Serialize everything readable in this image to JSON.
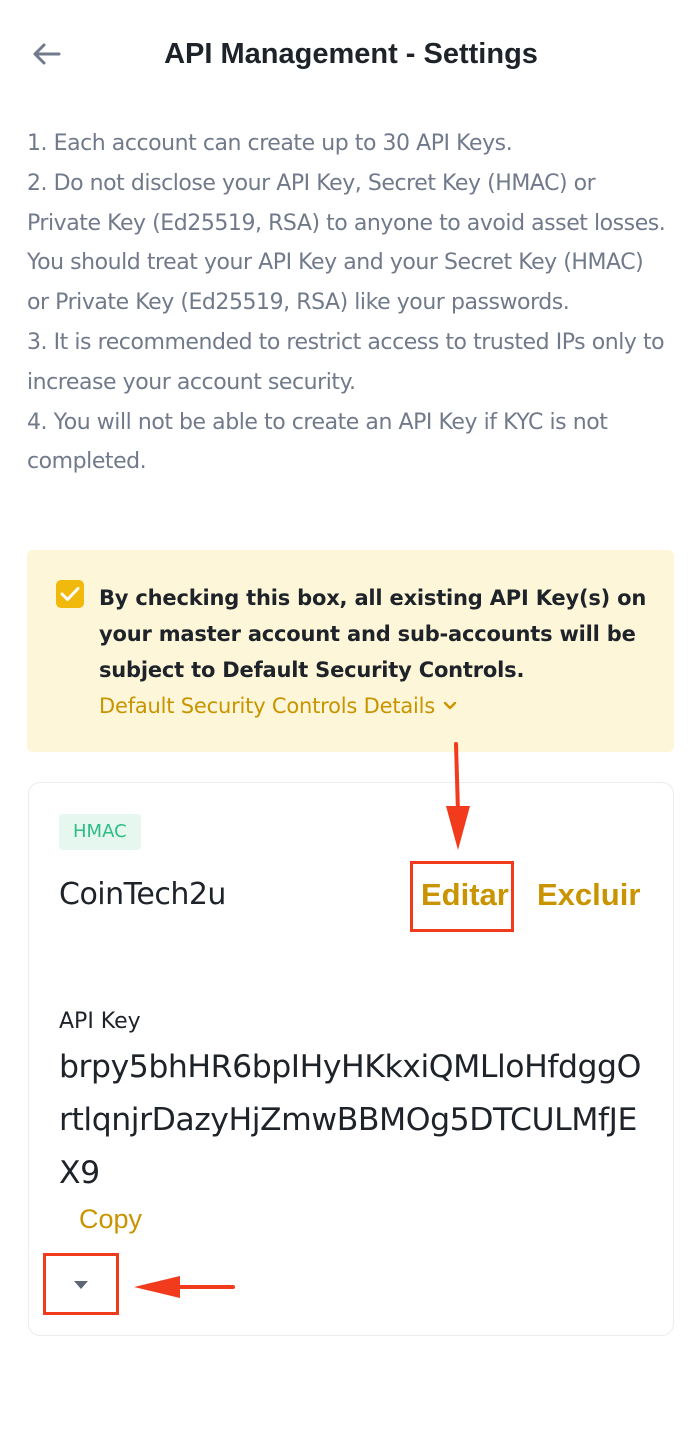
{
  "header": {
    "title": "API Management - Settings",
    "back_icon": "arrow-left-icon"
  },
  "notes": [
    "1. Each account can create up to 30 API Keys.",
    "2. Do not disclose your API Key, Secret Key (HMAC) or Private Key (Ed25519, RSA) to anyone to avoid asset losses. You should treat your API Key and your Secret Key (HMAC) or Private Key (Ed25519, RSA) like your passwords.",
    "3. It is recommended to restrict access to trusted IPs only to increase your account security.",
    "4. You will not be able to create an API Key if KYC is not completed."
  ],
  "security_controls": {
    "checked": true,
    "text": "By checking this box, all existing API Key(s) on your master account and sub-accounts will be subject to Default Security Controls.",
    "details_label": "Default Security Controls Details"
  },
  "api_card": {
    "type_badge": "HMAC",
    "name": "CoinTech2u",
    "edit_label": "Editar",
    "delete_label": "Excluir",
    "api_key_label": "API Key",
    "api_key_value": "brpy5bhHR6bpIHyHKkxiQMLloHfdggOrtlqnjrDazyHjZmwBBMOg5DTCULMfJEX9",
    "copy_label": "Copy",
    "expand_icon": "caret-down-icon"
  },
  "colors": {
    "accent": "#c99400",
    "checkbox": "#f0b90b",
    "warning_bg": "#fdf6d8",
    "badge_text": "#2ebd85",
    "badge_bg": "#e6f7f0",
    "annotation": "#f23a1c"
  }
}
